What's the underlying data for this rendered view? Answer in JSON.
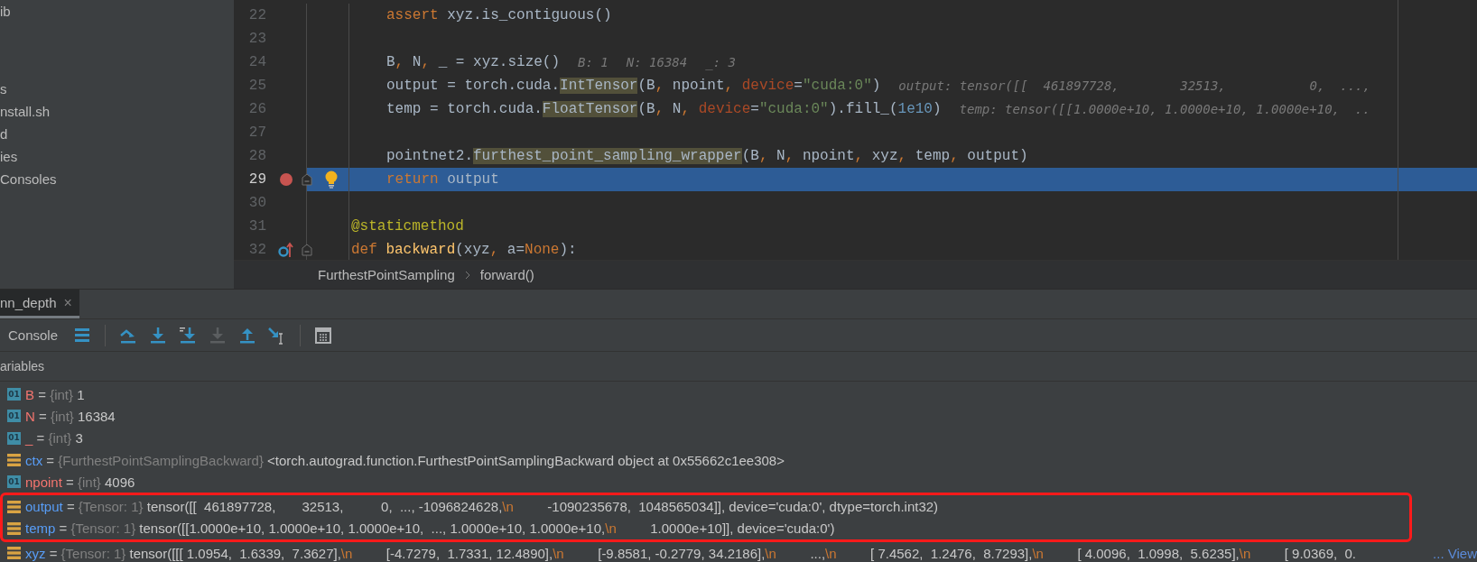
{
  "project_tree": {
    "items": [
      "ib",
      "s",
      "nstall.sh",
      "d",
      "ies",
      "Consoles"
    ]
  },
  "editor": {
    "lines": [
      {
        "number": "22",
        "kind": "body",
        "current": false,
        "breakpoint": false,
        "tokens": [
          {
            "text": "assert",
            "kind": "keyword"
          },
          {
            "text": " xyz.is_contiguous()",
            "kind": "plain"
          }
        ]
      },
      {
        "number": "23",
        "kind": "body",
        "current": false,
        "breakpoint": false
      },
      {
        "number": "24",
        "kind": "body",
        "current": false,
        "breakpoint": false,
        "tokens": [
          {
            "text": "B",
            "kind": "plain"
          },
          {
            "text": ",",
            "kind": "keyword"
          },
          {
            "text": " N",
            "kind": "plain"
          },
          {
            "text": ",",
            "kind": "keyword"
          },
          {
            "text": " _ = xyz.size()",
            "kind": "plain"
          }
        ],
        "hints": [
          "B: 1",
          "N: 16384",
          "_: 3"
        ]
      },
      {
        "number": "25",
        "kind": "body",
        "current": false,
        "breakpoint": false,
        "tokens": [
          {
            "text": "output = torch.cuda.",
            "kind": "plain"
          },
          {
            "text": "IntTensor",
            "kind": "usage"
          },
          {
            "text": "(B",
            "kind": "plain"
          },
          {
            "text": ",",
            "kind": "keyword"
          },
          {
            "text": " npoint",
            "kind": "plain"
          },
          {
            "text": ",",
            "kind": "keyword"
          },
          {
            "text": " device",
            "kind": "param"
          },
          {
            "text": "=",
            "kind": "plain"
          },
          {
            "text": "\"cuda:0\"",
            "kind": "string"
          },
          {
            "text": ")",
            "kind": "plain"
          }
        ],
        "hints": [
          "output: tensor([[  461897728,        32513,           0,  ...,"
        ]
      },
      {
        "number": "26",
        "kind": "body",
        "current": false,
        "breakpoint": false,
        "tokens": [
          {
            "text": "temp = torch.cuda.",
            "kind": "plain"
          },
          {
            "text": "FloatTensor",
            "kind": "usage"
          },
          {
            "text": "(B",
            "kind": "plain"
          },
          {
            "text": ",",
            "kind": "keyword"
          },
          {
            "text": " N",
            "kind": "plain"
          },
          {
            "text": ",",
            "kind": "keyword"
          },
          {
            "text": " device",
            "kind": "param"
          },
          {
            "text": "=",
            "kind": "plain"
          },
          {
            "text": "\"cuda:0\"",
            "kind": "string"
          },
          {
            "text": ").fill_(",
            "kind": "plain"
          },
          {
            "text": "1e10",
            "kind": "number"
          },
          {
            "text": ")",
            "kind": "plain"
          }
        ],
        "hints": [
          "temp: tensor([[1.0000e+10, 1.0000e+10, 1.0000e+10,  .."
        ]
      },
      {
        "number": "27",
        "kind": "body",
        "current": false,
        "breakpoint": false
      },
      {
        "number": "28",
        "kind": "body",
        "current": false,
        "breakpoint": false,
        "tokens": [
          {
            "text": "pointnet2.",
            "kind": "plain"
          },
          {
            "text": "furthest_point_sampling_wrapper",
            "kind": "usage"
          },
          {
            "text": "(B",
            "kind": "plain"
          },
          {
            "text": ",",
            "kind": "keyword"
          },
          {
            "text": " N",
            "kind": "plain"
          },
          {
            "text": ",",
            "kind": "keyword"
          },
          {
            "text": " npoint",
            "kind": "plain"
          },
          {
            "text": ",",
            "kind": "keyword"
          },
          {
            "text": " xyz",
            "kind": "plain"
          },
          {
            "text": ",",
            "kind": "keyword"
          },
          {
            "text": " temp",
            "kind": "plain"
          },
          {
            "text": ",",
            "kind": "keyword"
          },
          {
            "text": " output)",
            "kind": "plain"
          }
        ]
      },
      {
        "number": "29",
        "kind": "body",
        "current": true,
        "breakpoint": true,
        "fold": true,
        "bulb": true,
        "tokens": [
          {
            "text": "return",
            "kind": "keyword"
          },
          {
            "text": " output",
            "kind": "plain"
          }
        ]
      },
      {
        "number": "30",
        "kind": "body",
        "current": false,
        "breakpoint": false
      },
      {
        "number": "31",
        "kind": "member",
        "current": false,
        "breakpoint": false,
        "tokens": [
          {
            "text": "@staticmethod",
            "kind": "decorator"
          }
        ]
      },
      {
        "number": "32",
        "kind": "member",
        "current": false,
        "breakpoint": false,
        "fold": true,
        "override": true,
        "tokens": [
          {
            "text": "def",
            "kind": "keyword"
          },
          {
            "text": " backward",
            "kind": "function"
          },
          {
            "text": "(xyz",
            "kind": "plain"
          },
          {
            "text": ",",
            "kind": "keyword"
          },
          {
            "text": " a=",
            "kind": "plain"
          },
          {
            "text": "None",
            "kind": "keyword"
          },
          {
            "text": "):",
            "kind": "plain"
          }
        ]
      }
    ],
    "breadcrumbs": [
      "FurthestPointSampling",
      "forward()"
    ]
  },
  "debug_panel": {
    "tab": {
      "label": "nn_depth",
      "close": "×",
      "selected": true
    },
    "toolbar": {
      "console_label": "Console",
      "groups": [
        {
          "buttons": [
            {
              "kind": "frames",
              "disabled": false
            }
          ]
        },
        {
          "buttons": [
            {
              "kind": "stepover",
              "disabled": false
            },
            {
              "kind": "stepinto",
              "disabled": false
            },
            {
              "kind": "mycode",
              "disabled": false
            },
            {
              "kind": "forcestep",
              "disabled": true
            },
            {
              "kind": "stepout",
              "disabled": false
            },
            {
              "kind": "cursor",
              "disabled": false
            }
          ]
        },
        {
          "buttons": [
            {
              "kind": "evaluate",
              "disabled": false
            }
          ]
        }
      ]
    },
    "variables_title": "ariables",
    "variables": [
      {
        "kind": "int",
        "badge": "01",
        "name": "B",
        "operator": "=",
        "type": "{int}",
        "value": [
          {
            "text": "1",
            "kind": "plain"
          }
        ],
        "circled": false
      },
      {
        "kind": "int",
        "badge": "01",
        "name": "N",
        "operator": "=",
        "type": "{int}",
        "value": [
          {
            "text": "16384",
            "kind": "plain"
          }
        ],
        "circled": false
      },
      {
        "kind": "int",
        "badge": "01",
        "name": "_",
        "operator": "=",
        "type": "{int}",
        "value": [
          {
            "text": "3",
            "kind": "plain"
          }
        ],
        "circled": false
      },
      {
        "kind": "object",
        "name": "ctx",
        "operator": "=",
        "type": "{FurthestPointSamplingBackward}",
        "value": [
          {
            "text": "<torch.autograd.function.FurthestPointSamplingBackward object at 0x55662c1ee308>",
            "kind": "plain"
          }
        ],
        "circled": false
      },
      {
        "kind": "int",
        "badge": "01",
        "name": "npoint",
        "operator": "=",
        "type": "{int}",
        "value": [
          {
            "text": "4096",
            "kind": "plain"
          }
        ],
        "circled": false
      },
      {
        "kind": "object",
        "name": "output",
        "operator": "=",
        "type": "{Tensor: 1}",
        "value": [
          {
            "text": "tensor([[  461897728,       32513,          0,  ..., -1096824628,",
            "kind": "plain"
          },
          {
            "text": "\\n",
            "kind": "escape"
          },
          {
            "text": "         -1090235678,  1048565034]], device='cuda:0', dtype=torch.int32)",
            "kind": "plain"
          }
        ],
        "circled": true
      },
      {
        "kind": "object",
        "name": "temp",
        "operator": "=",
        "type": "{Tensor: 1}",
        "value": [
          {
            "text": "tensor([[1.0000e+10, 1.0000e+10, 1.0000e+10,  ..., 1.0000e+10, 1.0000e+10,",
            "kind": "plain"
          },
          {
            "text": "\\n",
            "kind": "escape"
          },
          {
            "text": "         1.0000e+10]], device='cuda:0')",
            "kind": "plain"
          }
        ],
        "circled": true
      },
      {
        "kind": "object",
        "name": "xyz",
        "operator": "=",
        "type": "{Tensor: 1}",
        "value": [
          {
            "text": "tensor([[[ 1.0954,  1.6339,  7.3627],",
            "kind": "plain"
          },
          {
            "text": "\\n",
            "kind": "escape"
          },
          {
            "text": "         [-4.7279,  1.7331, 12.4890],",
            "kind": "plain"
          },
          {
            "text": "\\n",
            "kind": "escape"
          },
          {
            "text": "         [-9.8581, -0.2779, 34.2186],",
            "kind": "plain"
          },
          {
            "text": "\\n",
            "kind": "escape"
          },
          {
            "text": "         ...,",
            "kind": "plain"
          },
          {
            "text": "\\n",
            "kind": "escape"
          },
          {
            "text": "         [ 7.4562,  1.2476,  8.7293],",
            "kind": "plain"
          },
          {
            "text": "\\n",
            "kind": "escape"
          },
          {
            "text": "         [ 4.0096,  1.0998,  5.6235],",
            "kind": "plain"
          },
          {
            "text": "\\n",
            "kind": "escape"
          },
          {
            "text": "         [ 9.0369,  0.",
            "kind": "plain"
          }
        ],
        "link": "... View",
        "circled": false
      }
    ]
  }
}
